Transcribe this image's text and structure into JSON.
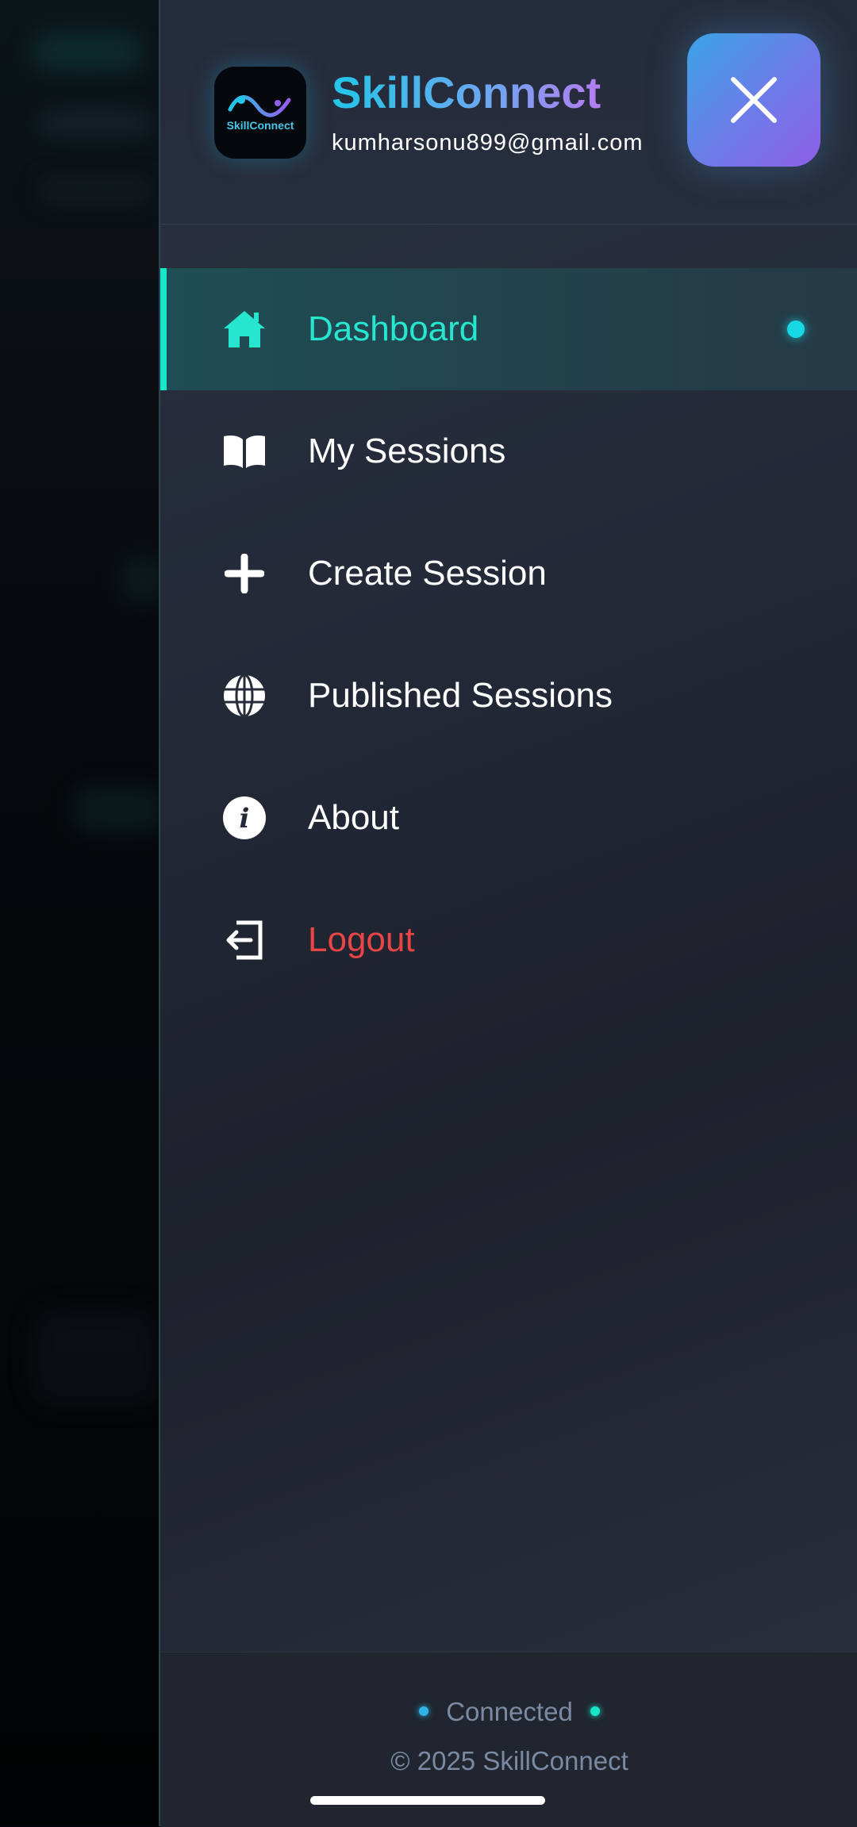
{
  "header": {
    "logo_text": "SkillConnect",
    "app_title": "SkillConnect",
    "user_email": "kumharsonu899@gmail.com",
    "close_icon": "close-icon"
  },
  "menu": {
    "items": [
      {
        "label": "Dashboard",
        "icon": "home-icon",
        "active": true
      },
      {
        "label": "My Sessions",
        "icon": "book-icon"
      },
      {
        "label": "Create Session",
        "icon": "plus-icon"
      },
      {
        "label": "Published Sessions",
        "icon": "globe-icon"
      },
      {
        "label": "About",
        "icon": "info-icon"
      },
      {
        "label": "Logout",
        "icon": "logout-icon"
      }
    ]
  },
  "footer": {
    "status": "Connected",
    "copyright": "© 2025 SkillConnect"
  },
  "colors": {
    "accent": "#18e6c9",
    "logout": "#e84545",
    "drawer_bg": "#232937"
  }
}
